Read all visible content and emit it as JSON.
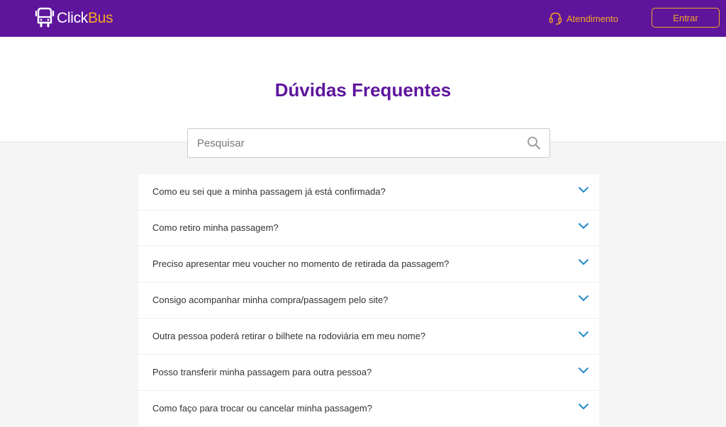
{
  "header": {
    "logo_click": "Click",
    "logo_bus": "Bus",
    "support_label": "Atendimento",
    "login_label": "Entrar"
  },
  "page": {
    "title": "Dúvidas Frequentes"
  },
  "search": {
    "placeholder": "Pesquisar",
    "value": ""
  },
  "faq": [
    {
      "question": "Como eu sei que a minha passagem já está confirmada?"
    },
    {
      "question": "Como retiro minha passagem?"
    },
    {
      "question": "Preciso apresentar meu voucher no momento de retirada da passagem?"
    },
    {
      "question": "Consigo acompanhar minha compra/passagem pelo site?"
    },
    {
      "question": "Outra pessoa poderá retirar o bilhete na rodoviária em meu nome?"
    },
    {
      "question": "Posso transferir minha passagem para outra pessoa?"
    },
    {
      "question": "Como faço para trocar ou cancelar minha passagem?"
    }
  ],
  "colors": {
    "brand_purple": "#5e159c",
    "accent_orange": "#f5a623",
    "chevron_blue": "#1f8acb"
  },
  "icons": {
    "logo": "bus-icon",
    "support": "headset-icon",
    "search": "search-icon",
    "expand": "chevron-down-icon"
  }
}
